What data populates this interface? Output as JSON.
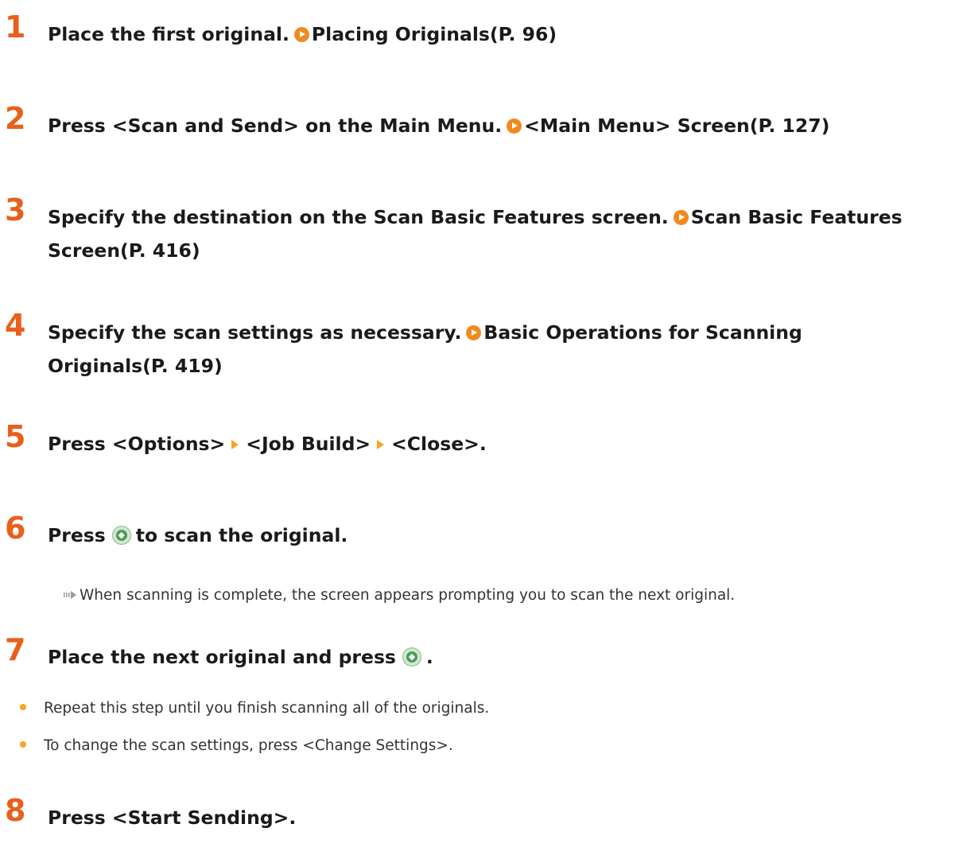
{
  "steps": [
    {
      "num": "1",
      "text": "Place the first original.",
      "link": "Placing Originals(P. 96)"
    },
    {
      "num": "2",
      "text": "Press <Scan and Send> on the Main Menu.",
      "link": "<Main Menu> Screen(P. 127)"
    },
    {
      "num": "3",
      "text": "Specify the destination on the Scan Basic Features screen.",
      "link_line1": "Scan Basic Features",
      "link_line2": "Screen(P. 416)"
    },
    {
      "num": "4",
      "text": "Specify the scan settings as necessary.",
      "link_line1": "Basic Operations for Scanning",
      "link_line2": "Originals(P. 419)"
    },
    {
      "num": "5",
      "part1": "Press <Options>",
      "part2": "<Job Build>",
      "part3": "<Close>."
    },
    {
      "num": "6",
      "before": "Press",
      "after": "to scan the original.",
      "result": "When scanning is complete, the screen appears prompting you to scan the next original."
    },
    {
      "num": "7",
      "before": "Place the next original and press",
      "after": ".",
      "bullets": [
        "Repeat this step until you finish scanning all of the originals.",
        "To change the scan settings, press <Change Settings>."
      ]
    },
    {
      "num": "8",
      "text": "Press <Start Sending>."
    }
  ],
  "icons": {
    "link": "circle-arrow-icon",
    "menu_separator": "triangle-arrow-icon",
    "start_key": "start-key-icon",
    "result_arrow": "result-arrow-icon",
    "bullet": "bullet-dot-icon"
  },
  "colors": {
    "step_number": "#e8601c",
    "link_icon": "#f08a1e",
    "separator": "#f5a623",
    "start_key": "#4e9a57"
  }
}
